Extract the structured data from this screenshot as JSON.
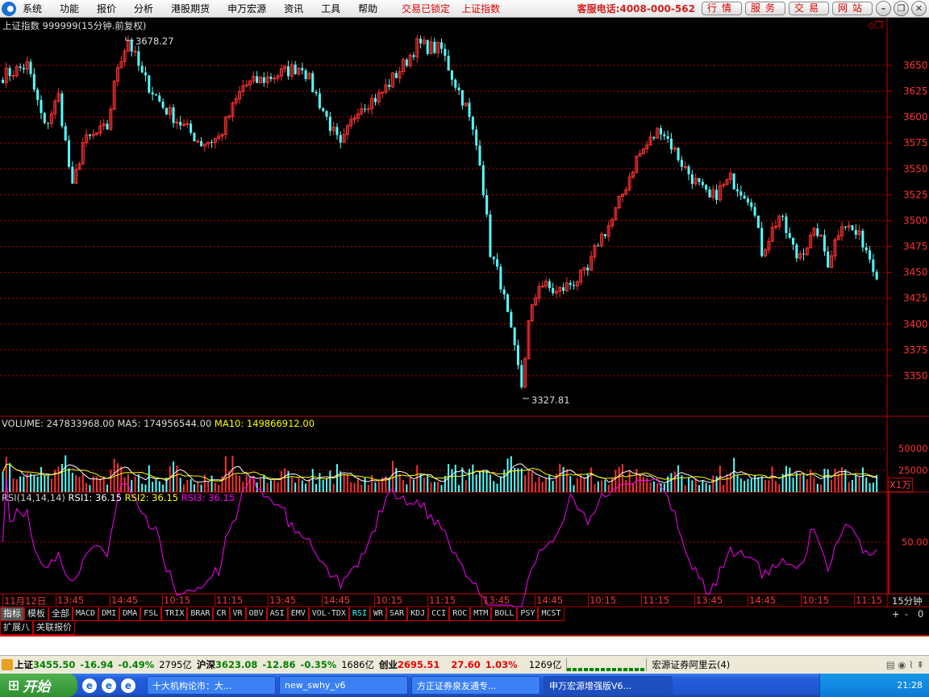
{
  "menubar": {
    "items": [
      "系统",
      "功能",
      "报价",
      "分析",
      "港股期货",
      "申万宏源",
      "资讯",
      "工具",
      "帮助"
    ],
    "lock_status": "交易已锁定",
    "current_index": "上证指数",
    "hotline": "客服电话:4008-000-562",
    "buttons": [
      "行情",
      "服务",
      "交易",
      "网站"
    ]
  },
  "chart": {
    "title": "上证指数 999999(15分钟.前复权)",
    "high_label": "3678.27",
    "low_label": "3327.81",
    "price_ticks": [
      "3650",
      "3625",
      "3600",
      "3575",
      "3550",
      "3525",
      "3500",
      "3475",
      "3450",
      "3425",
      "3400",
      "3375",
      "3350"
    ],
    "price_path": [
      [
        0,
        3640
      ],
      [
        7,
        3650
      ],
      [
        12,
        3590
      ],
      [
        16,
        3620
      ],
      [
        20,
        3530
      ],
      [
        23,
        3575
      ],
      [
        30,
        3590
      ],
      [
        33,
        3650
      ],
      [
        36,
        3675
      ],
      [
        40,
        3640
      ],
      [
        46,
        3610
      ],
      [
        57,
        3575
      ],
      [
        62,
        3580
      ],
      [
        69,
        3630
      ],
      [
        78,
        3640
      ],
      [
        86,
        3650
      ],
      [
        97,
        3570
      ],
      [
        102,
        3610
      ],
      [
        108,
        3620
      ],
      [
        115,
        3650
      ],
      [
        119,
        3670
      ],
      [
        126,
        3665
      ],
      [
        129,
        3640
      ],
      [
        133,
        3610
      ],
      [
        137,
        3560
      ],
      [
        140,
        3470
      ],
      [
        143,
        3440
      ],
      [
        149,
        3340
      ],
      [
        151,
        3400
      ],
      [
        154,
        3440
      ],
      [
        159,
        3430
      ],
      [
        168,
        3450
      ],
      [
        171,
        3480
      ],
      [
        175,
        3500
      ],
      [
        182,
        3560
      ],
      [
        189,
        3590
      ],
      [
        196,
        3550
      ],
      [
        203,
        3520
      ],
      [
        209,
        3540
      ],
      [
        215,
        3520
      ],
      [
        218,
        3470
      ],
      [
        223,
        3505
      ],
      [
        228,
        3465
      ],
      [
        234,
        3490
      ],
      [
        237,
        3460
      ],
      [
        241,
        3500
      ],
      [
        247,
        3480
      ],
      [
        251,
        3450
      ]
    ],
    "up_color": "#ff3232",
    "down_color": "#54ffff"
  },
  "volume": {
    "label": "VOLUME: 247833968.00",
    "ma5": "MA5: 174956544.00",
    "ma10": "MA10: 149866912.00",
    "ticks": [
      "50000",
      "25000"
    ],
    "unit": "X1万"
  },
  "rsi": {
    "label": "RSI(14,14,14)",
    "rsi1": "RSI1: 36.15",
    "rsi2": "RSI2: 36.15",
    "rsi3": "RSI3: 36.15",
    "tick": "50.00"
  },
  "time_axis": {
    "labels": [
      "11月12日",
      "13:45",
      "14:45",
      "10:15",
      "11:15",
      "13:45",
      "14:45",
      "10:15",
      "11:15",
      "13:45",
      "14:45",
      "10:15",
      "11:15",
      "13:45",
      "14:45",
      "10:15",
      "11:15"
    ],
    "period": "15分钟",
    "zoom_buttons": [
      "+",
      "-",
      "0"
    ]
  },
  "indicator_tabs": [
    "指标",
    "模板",
    "全部",
    "MACD",
    "DMI",
    "DMA",
    "FSL",
    "TRIX",
    "BRAR",
    "CR",
    "VR",
    "OBV",
    "ASI",
    "EMV",
    "VOL-TDX",
    "RSI",
    "WR",
    "SAR",
    "KDJ",
    "CCI",
    "ROC",
    "MTM",
    "BOLL",
    "PSY",
    "MCST"
  ],
  "ext_tabs": [
    "扩展八",
    "关联报价"
  ],
  "status": {
    "sh_name": "上证",
    "sh_val": "3455.50",
    "sh_chg": "-16.94",
    "sh_pct": "-0.49%",
    "sh_amt": "2795亿",
    "hs_name": "沪深",
    "hs_val": "3623.08",
    "hs_chg": "-12.86",
    "hs_pct": "-0.35%",
    "hs_amt": "1686亿",
    "cy_name": "创业",
    "cy_val": "2695.51",
    "cy_chg": "27.60",
    "cy_pct": "1.03%",
    "cy_amt": "1269亿",
    "server": "宏源证券阿里云(4)"
  },
  "taskbar": {
    "start": "开始",
    "tasks": [
      "十大机构论市：大...",
      "new_swhy_v6",
      "方正证券泉友通专...",
      "申万宏源增强版V6..."
    ],
    "clock": "21:28"
  }
}
